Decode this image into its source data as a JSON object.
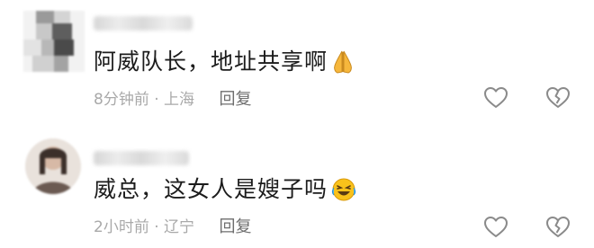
{
  "comments": [
    {
      "text": "阿威队长，地址共享啊",
      "emoji": "folded-hands-emoji",
      "time": "8分钟前",
      "location": "上海",
      "separator": "·",
      "reply_label": "回复"
    },
    {
      "text": "威总，这女人是嫂子吗",
      "emoji": "rolling-laughing-emoji",
      "time": "2小时前",
      "location": "辽宁",
      "separator": "·",
      "reply_label": "回复"
    }
  ],
  "colors": {
    "text": "#1c1c1c",
    "meta": "#a9a9a9",
    "reply": "#6e6e6e",
    "icon_stroke": "#8a8a8a"
  },
  "icons": [
    "heart-icon",
    "broken-heart-icon"
  ]
}
